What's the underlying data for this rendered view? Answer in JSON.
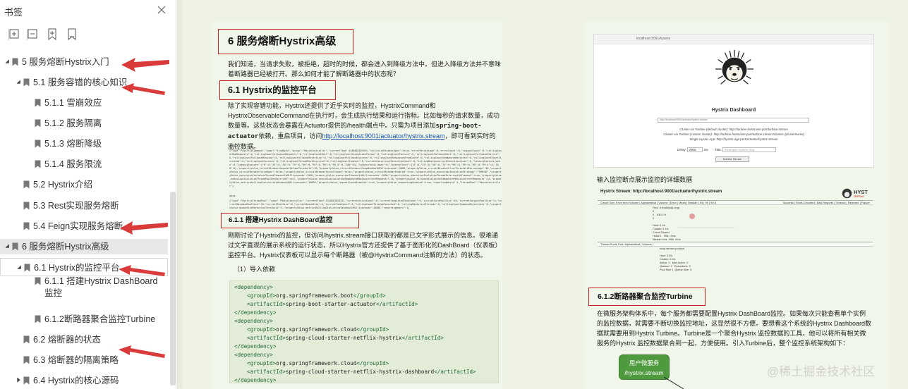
{
  "sidebar": {
    "title": "书签",
    "close_icon": "close-icon",
    "tools": [
      "expand-all-icon",
      "collapse-all-icon",
      "add-bookmark-icon",
      "bookmark-icon"
    ],
    "items": [
      {
        "label": "5 服务熔断Hystrix入门",
        "level": 0,
        "expanded": true
      },
      {
        "label": "5.1 服务容错的核心知识",
        "level": 1,
        "expanded": true
      },
      {
        "label": "5.1.1 雪崩效应",
        "level": 2
      },
      {
        "label": "5.1.2 服务隔离",
        "level": 2
      },
      {
        "label": "5.1.3 熔断降级",
        "level": 2
      },
      {
        "label": "5.1.4 服务限流",
        "level": 2
      },
      {
        "label": "5.2 Hystrix介绍",
        "level": 1
      },
      {
        "label": "5.3 Rest实现服务熔断",
        "level": 1
      },
      {
        "label": "5.4 Feign实现服务熔断",
        "level": 1
      },
      {
        "label": "6 服务熔断Hystrix高级",
        "level": 0,
        "expanded": true,
        "selected": true
      },
      {
        "label": "6.1 Hystrix的监控平台",
        "level": 1,
        "expanded": true,
        "outlined": true
      },
      {
        "label": "6.1.1 搭建Hystrix DashBoard",
        "label2": "监控",
        "level": 2
      },
      {
        "label": "6.1.2断路器聚合监控Turbine",
        "level": 2
      },
      {
        "label": "6.2 熔断器的状态",
        "level": 1
      },
      {
        "label": "6.3 熔断器的隔离策略",
        "level": 1
      },
      {
        "label": "6.4 Hystrix的核心源码",
        "level": 1,
        "expanded": false
      }
    ]
  },
  "document": {
    "h1": "6 服务熔断Hystrix高级",
    "intro": "我们知道，当请求失败，被拒绝，超时的时候，都会进入到降级方法中。但进入降级方法并不意味着断路器已经被打开。那么如何才能了解断路器中的状态呢？",
    "h2": "6.1 Hystrix的监控平台",
    "p2_a": "除了实现容错功能，Hystrix还提供了近乎实时的监控，HystrixCommand和HystrixObservableCommand在执行时，会生成执行结果和运行指标。比如每秒的请求数量，成功数量等。这些状态会暴露在Actuator提供的/health端点中。只需为项目添加",
    "p2_code": "spring-boot-actuator",
    "p2_b": "依赖，重启项目，访问",
    "p2_link": "http://localhost:9001/actuator/hystrix.stream",
    "p2_c": "，即可看到实时的监控数据。",
    "json_1": "data:",
    "json_2": "{\"type\":\"HystrixCommand\",\"name\":\"findById\",\"group\":\"MovieController\",\"currentTime\":1548663825551,\"isCircuitBreakerOpen\":false,\"errorPercentage\":0,\"errorCount\":0,\"requestCount\":0,\"rollingCountBadRequests\":0,\"rollingCountCollapsedRequests\":0,\"rollingCountEmit\":0,\"rollingCountExceptionsThrown\":0,\"rollingCountFailure\":0,\"rollingCountFallbackEmit\":0,\"rollingCountFallbackFailure\":0,\"rollingCountFallbackMissing\":0,\"rollingCountFallbackRejection\":0,\"rollingCountFallbackSuccess\":0,\"rollingCountResponsesFromCache\":0,\"rollingCountSemaphoreRejected\":0,\"rollingCountShortCircuited\":0,\"rollingCountSuccess\":0,\"rollingCountThreadPoolRejected\":0,\"rollingCountTimeout\":0,\"currentConcurrentExecutionCount\":0,\"rollingMaxConcurrentExecutionCount\":0,\"latencyExecute_mean\":0,\"latencyExecute\":{\"0\":0,\"25\":0,\"50\":0,\"75\":0,\"90\":0,\"95\":0,\"99\":0,\"99.5\":0,\"100\":0},\"latencyTotal_mean\":0,\"latencyTotal\":{\"0\":0,\"25\":0,\"50\":0,\"75\":0,\"90\":0,\"95\":0,\"99\":0,\"99.5\":0,\"100\":0},\"propertyValue_circuitBreakerRequestVolumeThreshold\":20,\"propertyValue_circuitBreakerSleepWindowInMilliseconds\":5000,\"propertyValue_circuitBreakerErrorThresholdPercentage\":50,\"propertyValue_circuitBreakerForceOpen\":false,\"propertyValue_circuitBreakerForceClosed\":false,\"propertyValue_circuitBreakerEnabled\":true,\"propertyValue_executionIsolationStrategy\":\"THREAD\",\"propertyValue_executionIsolationThreadTimeoutInMilliseconds\":1000,\"propertyValue_executionTimeoutInMilliseconds\":1000,\"propertyValue_executionIsolationThreadInterruptOnTimeout\":true,\"propertyValue_executionIsolationThreadPoolKeyOverride\":null,\"propertyValue_executionIsolationSemaphoreMaxConcurrentRequests\":10,\"propertyValue_fallbackIsolationSemaphoreMaxConcurrentRequests\":10,\"propertyValue_metricsRollingStatisticalWindowInMilliseconds\":10000,\"propertyValue_requestCacheEnabled\":true,\"propertyValue_requestLogEnabled\":true,\"reportingHosts\":1,\"threadPool\":\"MovieController\"}",
    "json_3": "data:",
    "json_4": "{\"type\":\"HystrixThreadPool\",\"name\":\"MovieController\",\"currentTime\":1548663825551,\"currentActiveCount\":0,\"currentCompletedTaskCount\":0,\"currentCorePoolSize\":10,\"currentLargestPoolSize\":0,\"currentMaximumPoolSize\":10,\"currentPoolSize\":0,\"currentQueueSize\":0,\"currentTaskCount\":0,\"rollingCountThreadsExecuted\":0,\"rollingMaxActiveThreads\":0,\"rollingCountCommandRejections\":0,\"propertyValue_queueSizeRejectionThreshold\":5,\"propertyValue_metricsRollingStatisticalWindowInMilliseconds\":10000,\"reportingHosts\":1}",
    "h3": "6.1.1 搭建Hystrix DashBoard监控",
    "p3": "刚刚讨论了Hystrix的监控，但访问/hystrix.stream接口获取的都是已文字形式展示的信息。很难通过文字直观的展示系统的运行状态，所以Hystrix官方还提供了基于图形化的DashBoard（仪表板）监控平台。Hystrix仪表板可以显示每个断路器（被@HystrixCommand注解的方法）的状态。",
    "p4": "（1）导入依赖",
    "code": [
      {
        "t": "tag",
        "v": "<dependency>"
      },
      {
        "t": "line",
        "pre": "<groupId>",
        "txt": "org.springframework.boot",
        "post": "</groupId>"
      },
      {
        "t": "line",
        "pre": "<artifactId>",
        "txt": "spring-boot-starter-actuator",
        "post": "</artifactId>"
      },
      {
        "t": "tag",
        "v": "</dependency>"
      },
      {
        "t": "tag",
        "v": "<dependency>"
      },
      {
        "t": "line",
        "pre": "<groupId>",
        "txt": "org.springframework.cloud",
        "post": "</groupId>"
      },
      {
        "t": "line",
        "pre": "<artifactId>",
        "txt": "spring-cloud-starter-netflix-hystrix",
        "post": "</artifactId>"
      },
      {
        "t": "tag",
        "v": "</dependency>"
      },
      {
        "t": "tag",
        "v": "<dependency>"
      },
      {
        "t": "line",
        "pre": "<groupId>",
        "txt": "org.springframework.cloud",
        "post": "</groupId>"
      },
      {
        "t": "line",
        "pre": "<artifactId>",
        "txt": "spring-cloud-starter-netflix-hystrix-dashboard",
        "post": "</artifactId>"
      },
      {
        "t": "tag",
        "v": "</dependency>"
      }
    ],
    "shot_url": "localhost:9001/hystrix",
    "hd_title": "Hystrix Dashboard",
    "hd_input": "http://localhost:9001/actuator/hystrix.stream",
    "hd_line1": "Cluster via Turbine (default cluster): http://turbine-hostname:port/turbine.stream",
    "hd_line2": "Cluster via Turbine (custom cluster): http://turbine-hostname:port/turbine.stream?cluster=[clusterName]",
    "hd_line3": "Single Hystrix App: http://hystrix-app:port/actuator/hystrix.stream",
    "hd_delay_label": "Delay:",
    "hd_delay_value": "2000",
    "hd_delay_unit": "ms",
    "hd_title_label": "Title:",
    "hd_title_placeholder": "Example Hystrix App",
    "hd_button": "Monitor Stream",
    "hs_caption": "输入监控断点展示监控的详细数据",
    "hs_title": "Hystrix Stream: http://localhost:9001/actuator/hystrix.stream",
    "hs_logo": "HYST",
    "hs_logo2": "DEFEND",
    "hs_circuit": "Circuit  Sort: Error then Volume | Alphabetical | Volume | Error | Mean | Median | 90 | 99 | 99.5",
    "hs_circuit_right": "Success | Short-Circuited | Bad Request | Timeout | Rejected | Failure",
    "hs_circuit_body": "Find...ll,findById(Long)\n0\n0   100.0 %\n0\n\nHost: 0.1/s\nCluster: 0.1/s\nCircuit Closed\nHosts 1   90th  0ms\nMedian 0ms  99th  0ms\nMean 0ms  99.5th 0ms",
    "hs_thread": "Thread Pools  Sort: Alphabetical | Volume |",
    "hs_thread_body": "shop.service.product\n\nHost: 0.0/s\nCluster: 0.0/s\nActive  0   Max Active  0\nQueued  0   Executions  0\nPool Size 1  Queue Size  5",
    "h4": "6.1.2断路器聚合监控Turbine",
    "p5": "在微服务架构体系中，每个服务都需要配置Hystrix DashBoard监控。如果每次只能查看单个实例的监控数据，就需要不断切换监控地址，这显然很不方便。要想看这个系统的Hystrix Dashboard数据就需要用到Hystrix Turbine。Turbine是一个聚合Hystrix 监控数据的工具，他可以将所有相关微服务的Hystrix 监控数据聚合到一起，方便使用。引入Turbine后，整个监控系统架构如下：",
    "svc_line1": "用户微服务",
    "svc_line2": "/hystrix.stream",
    "watermark": "@稀土掘金技术社区"
  },
  "colors": {
    "accent_red": "#d93a3a",
    "page_bg": "#eef3e6",
    "service_box": "#4f9a3f"
  }
}
